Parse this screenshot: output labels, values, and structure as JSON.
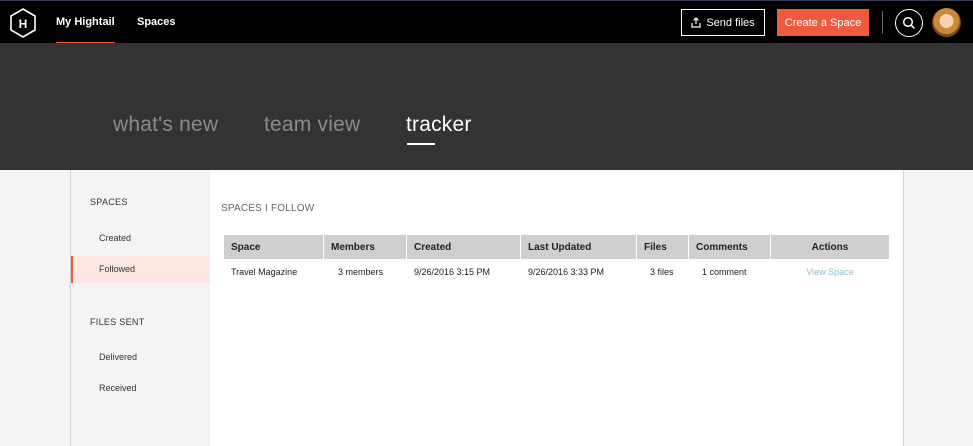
{
  "nav": {
    "logo_letter": "H",
    "links": [
      "My Hightail",
      "Spaces"
    ],
    "send_files_label": "Send files",
    "create_space_label": "Create a Space"
  },
  "hero": {
    "tabs": [
      "what's new",
      "team view",
      "tracker"
    ],
    "active_tab": "tracker"
  },
  "sidebar": {
    "spaces_heading": "SPACES",
    "spaces_items": [
      "Created",
      "Followed"
    ],
    "active_item": "Followed",
    "files_heading": "FILES SENT",
    "files_items": [
      "Delivered",
      "Received"
    ]
  },
  "main": {
    "title": "SPACES I FOLLOW",
    "columns": [
      "Space",
      "Members",
      "Created",
      "Last Updated",
      "Files",
      "Comments",
      "Actions"
    ],
    "rows": [
      {
        "space": "Travel Magazine",
        "members": "3 members",
        "created": "9/26/2016 3:15 PM",
        "last_updated": "9/26/2016 3:33 PM",
        "files": "3 files",
        "comments": "1 comment",
        "action": "View Space"
      }
    ]
  },
  "colors": {
    "accent": "#f05a3c",
    "hero_bg": "#333336",
    "link": "#8fbccd"
  }
}
